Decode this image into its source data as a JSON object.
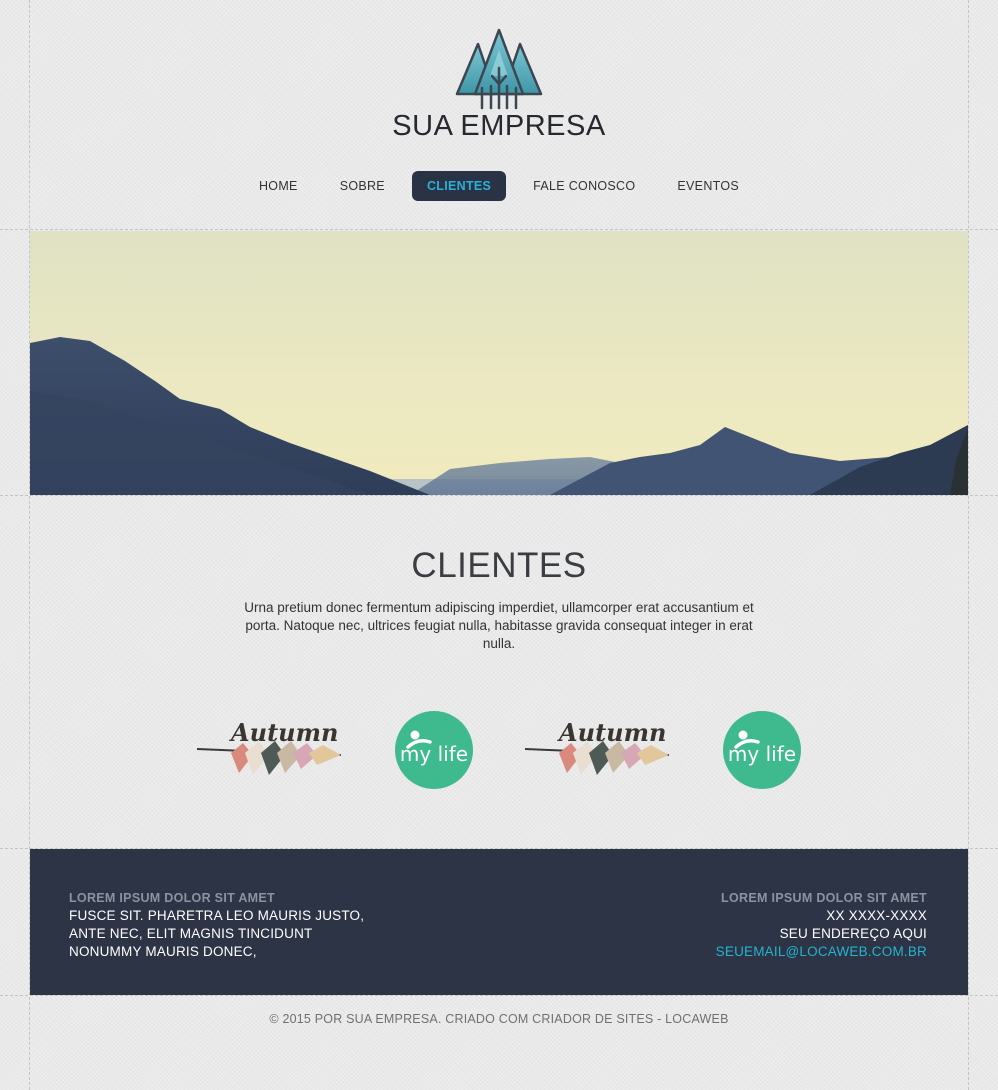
{
  "brand": {
    "name": "SUA EMPRESA"
  },
  "nav": {
    "items": [
      {
        "label": "HOME",
        "active": false
      },
      {
        "label": "SOBRE",
        "active": false
      },
      {
        "label": "CLIENTES",
        "active": true
      },
      {
        "label": "FALE CONOSCO",
        "active": false
      },
      {
        "label": "EVENTOS",
        "active": false
      }
    ]
  },
  "main": {
    "title": "CLIENTES",
    "text_line1": "Urna pretium donec fermentum adipiscing imperdiet, ullamcorper erat accusantium et",
    "text_line2": "porta. Natoque nec, ultrices feugiat nulla, habitasse gravida consequat integer in erat nulla.",
    "clients": [
      {
        "name": "Autumn"
      },
      {
        "name": "my life"
      },
      {
        "name": "Autumn"
      },
      {
        "name": "my life"
      }
    ]
  },
  "footer": {
    "left": {
      "heading": "LOREM IPSUM DOLOR SIT AMET",
      "lines": [
        "FUSCE SIT. PHARETRA LEO MAURIS JUSTO,",
        "ANTE NEC, ELIT MAGNIS TINCIDUNT",
        "NONUMMY MAURIS DONEC,"
      ]
    },
    "right": {
      "heading": "LOREM IPSUM DOLOR SIT AMET",
      "phone": "XX XXXX-XXXX",
      "address": "SEU ENDEREÇO AQUI",
      "email": "SEUEMAIL@LOCAWEB.COM.BR"
    }
  },
  "copyright": "© 2015 POR SUA EMPRESA. CRIADO COM CRIADOR DE SITES - LOCAWEB",
  "colors": {
    "nav_active_bg": "#2a3346",
    "accent": "#2ab1d6",
    "footer_bg": "#2c3446",
    "mylife_green": "#3fb98e"
  },
  "icons": {
    "logo": "mountain-trees-logo-icon"
  }
}
